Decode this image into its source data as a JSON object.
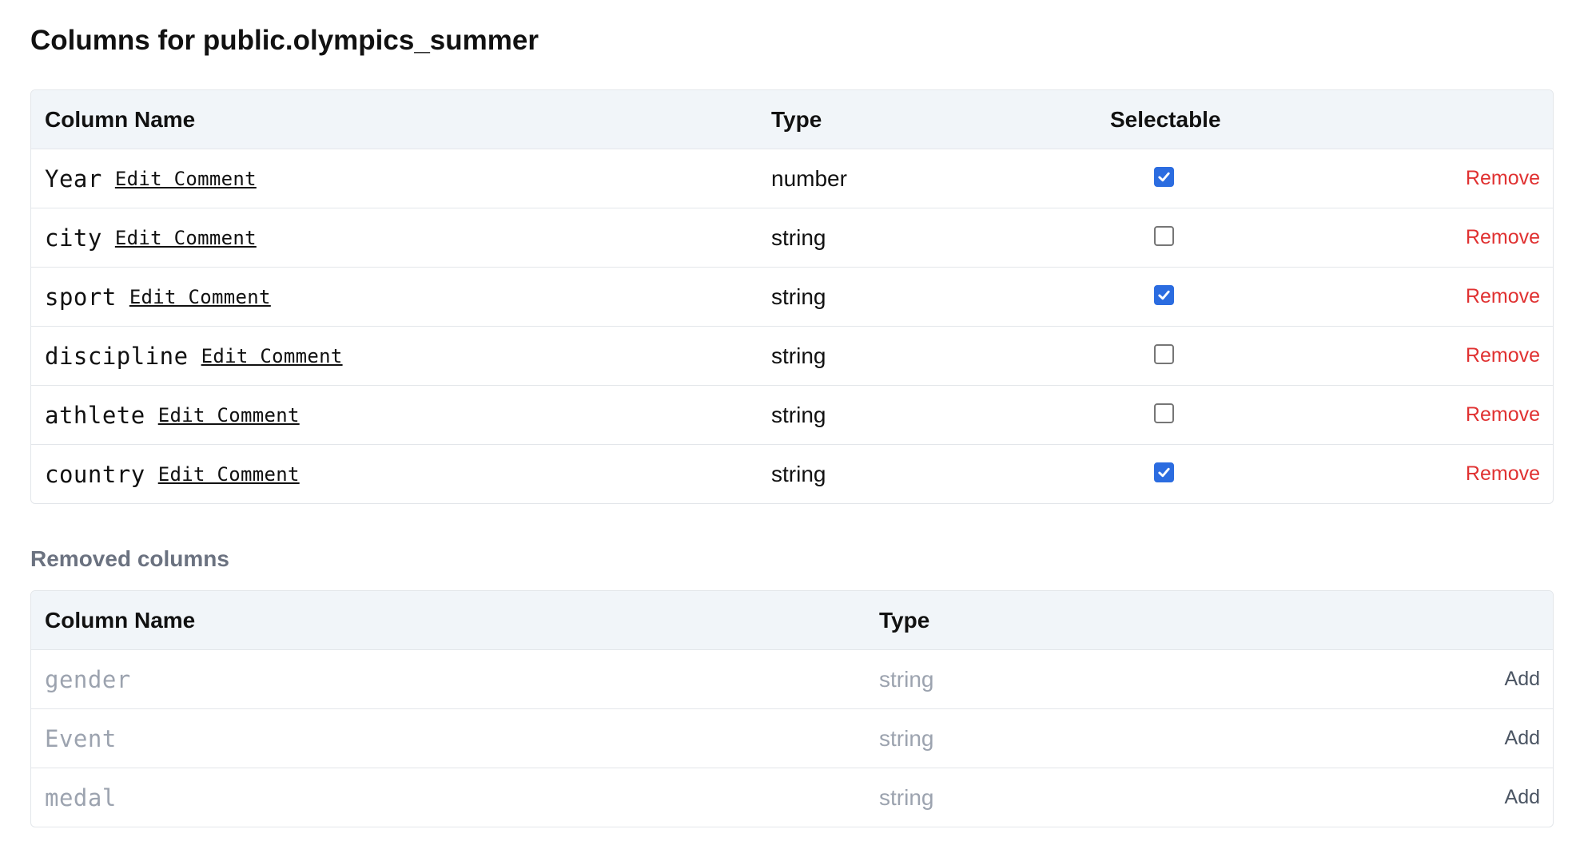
{
  "page": {
    "title": "Columns for public.olympics_summer"
  },
  "active_table": {
    "headers": {
      "name": "Column Name",
      "type": "Type",
      "selectable": "Selectable"
    },
    "edit_comment_label": "Edit Comment",
    "remove_label": "Remove",
    "rows": [
      {
        "name": "Year",
        "edit": "Edit Comment",
        "type": "number",
        "selectable": true,
        "action": "Remove"
      },
      {
        "name": "city",
        "edit": "Edit Comment",
        "type": "string",
        "selectable": false,
        "action": "Remove"
      },
      {
        "name": "sport",
        "edit": "Edit Comment",
        "type": "string",
        "selectable": true,
        "action": "Remove"
      },
      {
        "name": "discipline",
        "edit": "Edit Comment",
        "type": "string",
        "selectable": false,
        "action": "Remove"
      },
      {
        "name": "athlete",
        "edit": "Edit Comment",
        "type": "string",
        "selectable": false,
        "action": "Remove"
      },
      {
        "name": "country",
        "edit": "Edit Comment",
        "type": "string",
        "selectable": true,
        "action": "Remove"
      }
    ]
  },
  "removed_section": {
    "title": "Removed columns",
    "headers": {
      "name": "Column Name",
      "type": "Type"
    },
    "rows": [
      {
        "name": "gender",
        "type": "string",
        "action": "Add"
      },
      {
        "name": "Event",
        "type": "string",
        "action": "Add"
      },
      {
        "name": "medal",
        "type": "string",
        "action": "Add"
      }
    ]
  },
  "colors": {
    "accent": "#2b6ce0",
    "danger": "#e03131",
    "header_bg": "#f1f5f9",
    "muted": "#9ca3af"
  }
}
